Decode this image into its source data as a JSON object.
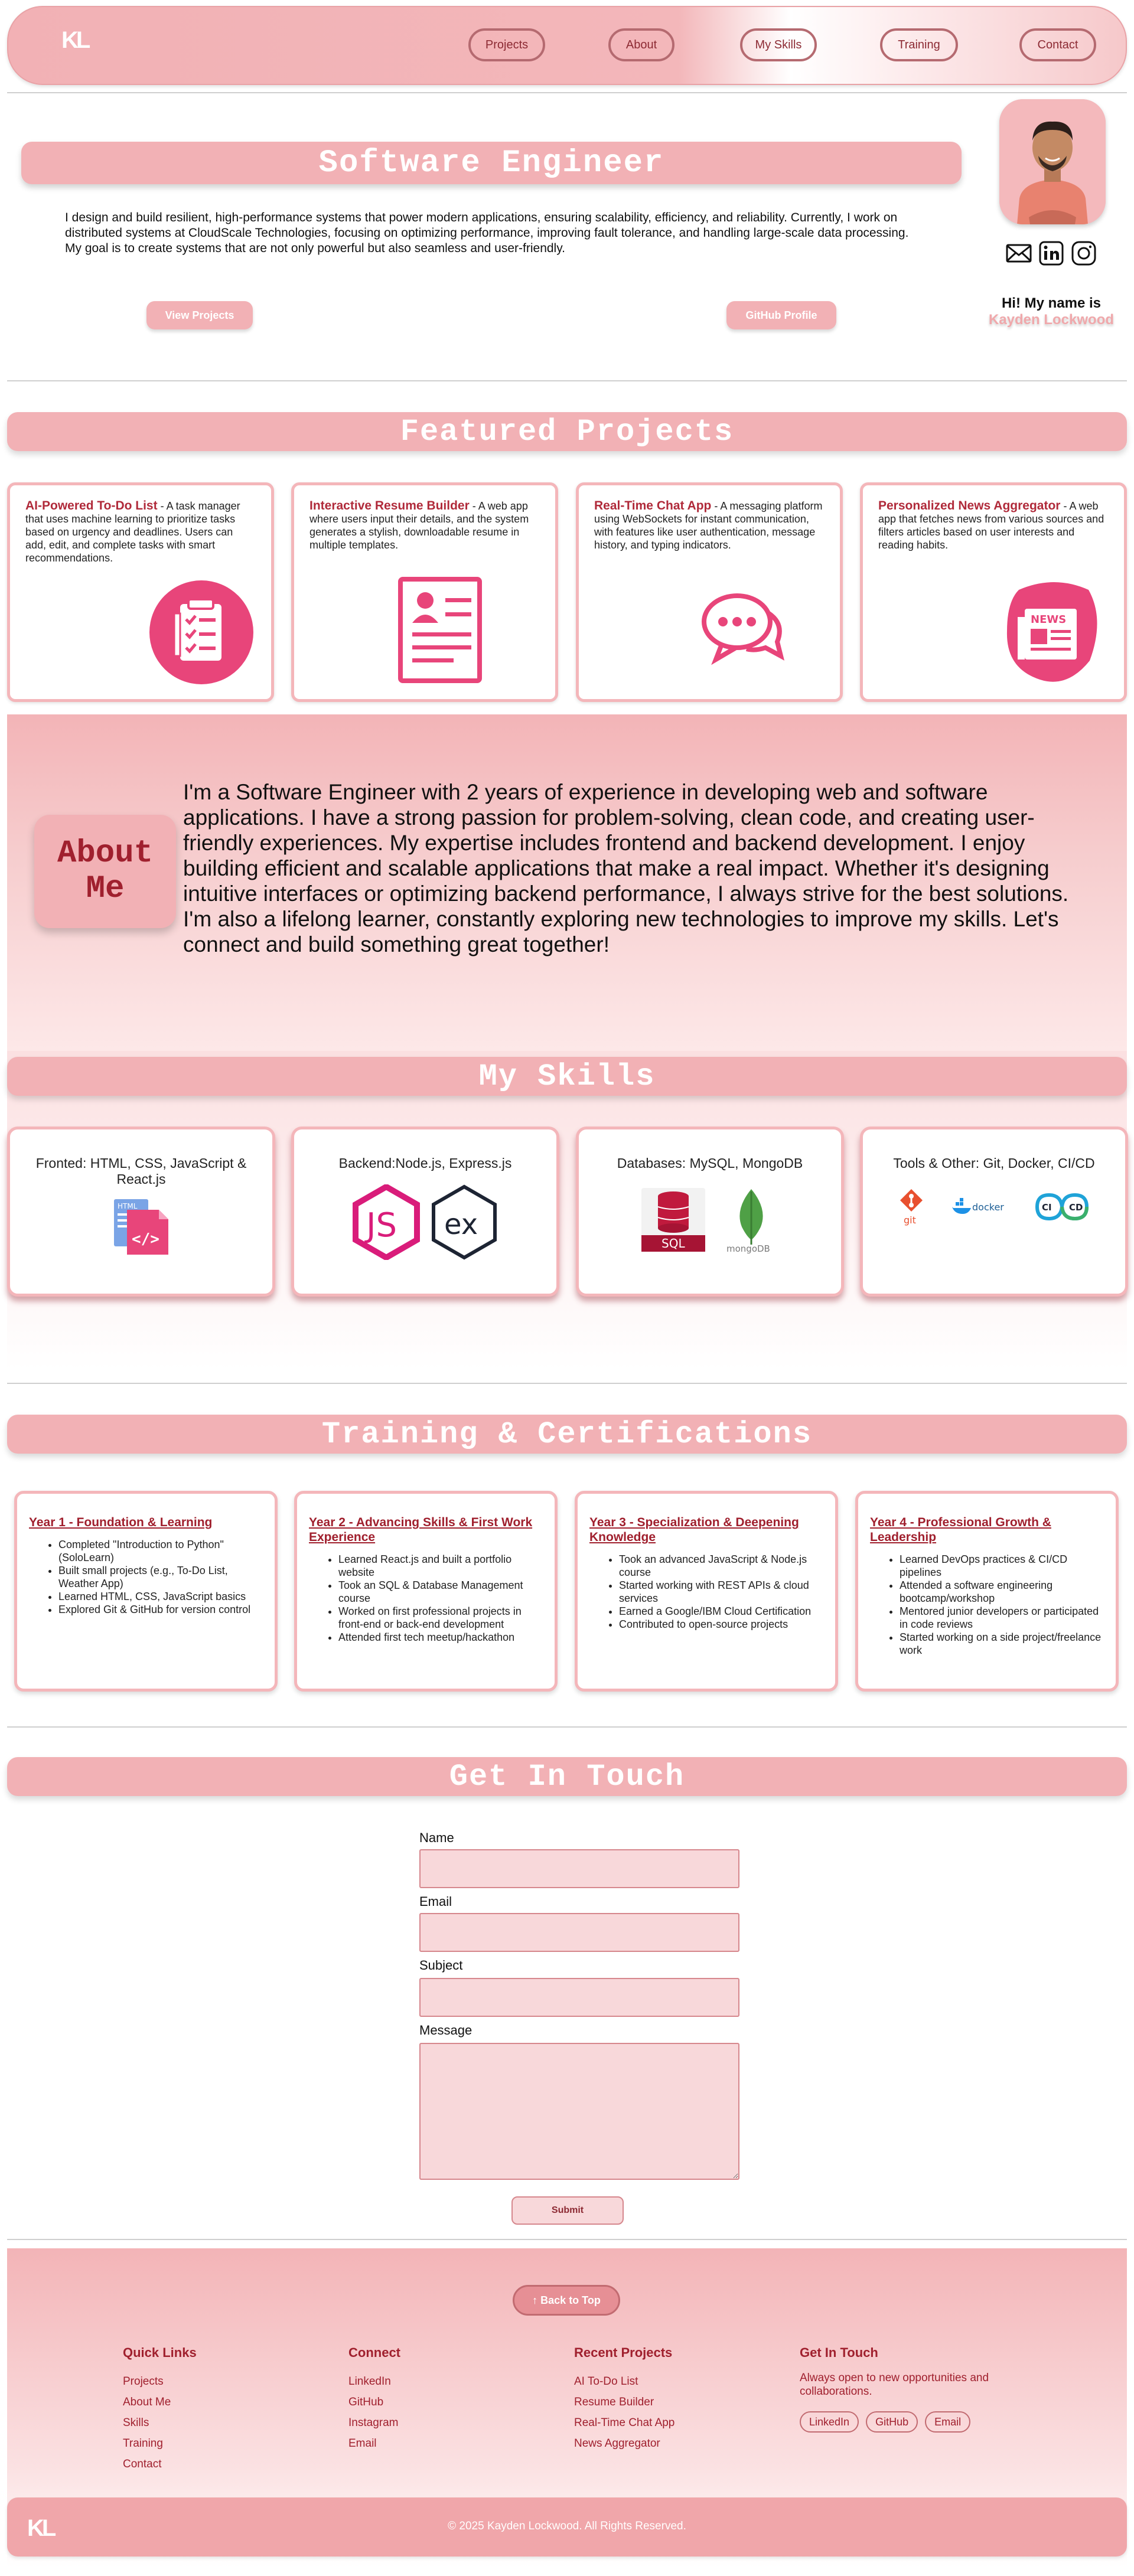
{
  "nav": {
    "logo": "KL",
    "links": [
      "Projects",
      "About",
      "My Skills",
      "Training",
      "Contact"
    ]
  },
  "hero": {
    "title": "Software Engineer",
    "description": "I design and build resilient, high-performance systems that power modern applications, ensuring scalability, efficiency, and reliability. Currently, I work on distributed systems at CloudScale Technologies, focusing on optimizing performance, improving fault tolerance, and handling large-scale data processing. My goal is to create systems that are not only powerful but also seamless and user-friendly.",
    "btn_projects": "View Projects",
    "btn_github": "GitHub Profile",
    "greeting": "Hi! My name is",
    "name": "Kayden Lockwood"
  },
  "projects": {
    "heading": "Featured Projects",
    "items": [
      {
        "title": "AI-Powered To-Do List",
        "desc": " - A task manager that uses machine learning to prioritize tasks based on urgency and deadlines. Users can add, edit, and complete tasks with smart recommendations.",
        "icon": "checklist-icon"
      },
      {
        "title": "Interactive Resume Builder",
        "desc": " - A web app where users input their details, and the system generates a stylish, downloadable resume in multiple templates.",
        "icon": "resume-icon"
      },
      {
        "title": "Real-Time Chat App",
        "desc": " - A messaging platform using WebSockets for instant communication, with features like user authentication, message history, and typing indicators.",
        "icon": "chat-icon"
      },
      {
        "title": "Personalized News Aggregator",
        "desc": " - A web app that fetches news from various sources and filters articles based on user interests and reading habits.",
        "icon": "news-icon"
      }
    ]
  },
  "about": {
    "heading": "About Me",
    "text": "I'm a Software Engineer with 2 years of experience in developing web and software applications. I have a strong passion for problem-solving, clean code, and creating user-friendly experiences. My expertise includes frontend and backend development. I enjoy building efficient and scalable applications that make a real impact. Whether it's designing intuitive interfaces or optimizing backend performance, I always strive for the best solutions. I'm also a lifelong learner, constantly exploring new technologies to improve my skills. Let's connect and build something great together!"
  },
  "skills": {
    "heading": "My Skills",
    "items": [
      {
        "label": "Fronted: HTML, CSS, JavaScript & React.js"
      },
      {
        "label": "Backend:Node.js, Express.js"
      },
      {
        "label": "Databases: MySQL, MongoDB",
        "sql_label": "SQL",
        "mongo_label": "mongoDB"
      },
      {
        "label": "Tools & Other: Git, Docker, CI/CD",
        "git_label": "git",
        "docker_label": "docker",
        "cicd_ci": "CI",
        "cicd_cd": "CD"
      }
    ],
    "js_glyph": "JS",
    "ex_glyph": "ex",
    "html_badge": "HTML"
  },
  "training": {
    "heading": "Training & Certifications",
    "items": [
      {
        "title": "Year 1 - Foundation & Learning",
        "points": [
          "Completed \"Introduction to Python\" (SoloLearn)",
          "Built small projects (e.g., To-Do List, Weather App)",
          "Learned HTML, CSS, JavaScript basics",
          "Explored Git & GitHub for version control"
        ]
      },
      {
        "title": "Year 2 - Advancing Skills & First Work Experience",
        "points": [
          "Learned React.js and built a portfolio website",
          "Took an SQL & Database Management course",
          "Worked on first professional projects in front-end or back-end development",
          "Attended first tech meetup/hackathon"
        ]
      },
      {
        "title": "Year 3 - Specialization & Deepening Knowledge",
        "points": [
          "Took an advanced JavaScript & Node.js course",
          "Started working with REST APIs & cloud services",
          "Earned a Google/IBM Cloud Certification",
          "Contributed to open-source projects"
        ]
      },
      {
        "title": "Year 4 - Professional Growth & Leadership",
        "points": [
          "Learned DevOps practices & CI/CD pipelines",
          "Attended a software engineering bootcamp/workshop",
          "Mentored junior developers or participated in code reviews",
          "Started working on a side project/freelance work"
        ]
      }
    ]
  },
  "contact": {
    "heading": "Get In Touch",
    "name_label": "Name",
    "email_label": "Email",
    "subject_label": "Subject",
    "message_label": "Message",
    "submit": "Submit"
  },
  "footer": {
    "back_to_top": "↑ Back to Top",
    "quick_links": {
      "title": "Quick Links",
      "items": [
        "Projects",
        "About Me",
        "Skills",
        "Training",
        "Contact"
      ]
    },
    "connect": {
      "title": "Connect",
      "items": [
        "LinkedIn",
        "GitHub",
        "Instagram",
        "Email"
      ]
    },
    "recent": {
      "title": "Recent Projects",
      "items": [
        "AI To-Do List",
        "Resume Builder",
        "Real-Time Chat App",
        "News Aggregator"
      ]
    },
    "touch": {
      "title": "Get In Touch",
      "text": "Always open to new opportunities and collaborations.",
      "chips": [
        "LinkedIn",
        "GitHub",
        "Email"
      ]
    },
    "logo": "KL",
    "copyright": "© 2025 Kayden Lockwood. All Rights Reserved."
  },
  "colors": {
    "accent": "#f2b1b5",
    "dark_accent": "#a0202e",
    "icon_pink": "#e8457a"
  }
}
